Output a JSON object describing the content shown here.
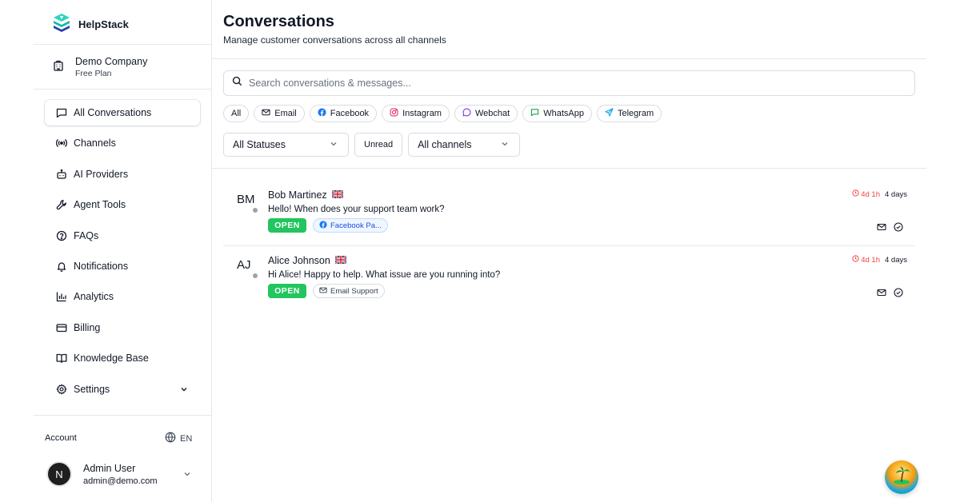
{
  "app": {
    "name": "HelpStack"
  },
  "company": {
    "name": "Demo Company",
    "plan": "Free Plan"
  },
  "nav": {
    "items": [
      {
        "label": "All Conversations",
        "icon": "chat-bubble-icon"
      },
      {
        "label": "Channels",
        "icon": "broadcast-icon"
      },
      {
        "label": "AI Providers",
        "icon": "bot-icon"
      },
      {
        "label": "Agent Tools",
        "icon": "wrench-icon"
      },
      {
        "label": "FAQs",
        "icon": "help-circle-icon"
      },
      {
        "label": "Notifications",
        "icon": "bell-icon"
      },
      {
        "label": "Analytics",
        "icon": "bar-chart-icon"
      },
      {
        "label": "Billing",
        "icon": "credit-card-icon"
      },
      {
        "label": "Knowledge Base",
        "icon": "book-icon"
      },
      {
        "label": "Settings",
        "icon": "gear-icon"
      }
    ]
  },
  "account": {
    "label": "Account",
    "language": "EN"
  },
  "user": {
    "initial": "N",
    "name": "Admin User",
    "email": "admin@demo.com"
  },
  "page": {
    "title": "Conversations",
    "subtitle": "Manage customer conversations across all channels"
  },
  "search": {
    "placeholder": "Search conversations & messages..."
  },
  "channel_chips": [
    "All",
    "Email",
    "Facebook",
    "Instagram",
    "Webchat",
    "WhatsApp",
    "Telegram"
  ],
  "filters": {
    "status": "All Statuses",
    "unread": "Unread",
    "channel": "All channels"
  },
  "conversations": [
    {
      "initials": "BM",
      "name": "Bob Martinez",
      "flag": "🇬🇧",
      "message": "Hello! When does your support team work?",
      "status": "OPEN",
      "channel": "Facebook Pa...",
      "sla": "4d 1h",
      "age": "4 days"
    },
    {
      "initials": "AJ",
      "name": "Alice Johnson",
      "flag": "🇬🇧",
      "message": "Hi Alice! Happy to help. What issue are you running into?",
      "status": "OPEN",
      "channel": "Email Support",
      "sla": "4d 1h",
      "age": "4 days"
    }
  ],
  "colors": {
    "open_badge": "#22c55e",
    "sla_warning": "#ef4444",
    "facebook": "#1877f2",
    "instagram": "#e1306c",
    "webchat": "#7c3aed",
    "whatsapp": "#16a34a",
    "telegram": "#0ea5e9"
  }
}
